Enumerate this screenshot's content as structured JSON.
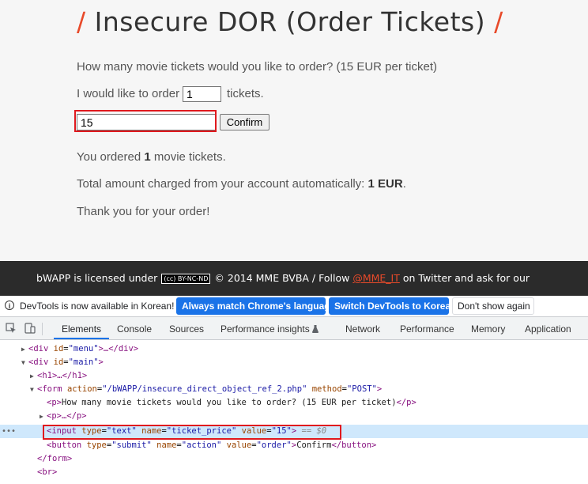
{
  "page": {
    "title_slash": "/",
    "title": "Insecure DOR (Order Tickets)",
    "question": "How many movie tickets would you like to order? (15 EUR per ticket)",
    "order_prefix": "I would like to order",
    "order_qty_value": "1",
    "order_suffix": "tickets.",
    "ticket_price_value": "15",
    "confirm_label": "Confirm",
    "ordered_prefix": "You ordered",
    "ordered_count": "1",
    "ordered_suffix": "movie tickets.",
    "total_prefix": "Total amount charged from your account automatically:",
    "total_amount": "1 EUR",
    "total_suffix": ".",
    "thanks": "Thank you for your order!"
  },
  "footer": {
    "licensed_prefix": "bWAPP is licensed under",
    "cc_badge": "(cc) BY-NC-ND",
    "copyright": "© 2014 MME BVBA / Follow",
    "twitter_handle": "@MME_IT",
    "suffix": "on Twitter and ask for our"
  },
  "devtools": {
    "infobar": {
      "icon": "info-icon",
      "text": "DevTools is now available in Korean!",
      "btn_match": "Always match Chrome's language",
      "btn_switch": "Switch DevTools to Korean",
      "btn_dont_show": "Don't show again"
    },
    "tabs": [
      "Elements",
      "Console",
      "Sources",
      "Performance insights",
      "Network",
      "Performance",
      "Memory",
      "Application"
    ],
    "active_tab": "Elements",
    "tree": {
      "r0": {
        "open": "<div",
        "attr": "id",
        "val": "\"menu\"",
        "close_tag": ">…</div>"
      },
      "r1": {
        "open": "<div",
        "attr": "id",
        "val": "\"main\"",
        "close_tag": ">"
      },
      "r2": {
        "tag": "<h1>…</h1>"
      },
      "r3": {
        "open": "<form",
        "attr1": "action",
        "val1": "\"/bWAPP/insecure_direct_object_ref_2.php\"",
        "attr2": "method",
        "val2": "\"POST\"",
        "close_tag": ">"
      },
      "r4": {
        "open": "<p>",
        "text": "How many movie tickets would you like to order? (15 EUR per ticket)",
        "close": "</p>"
      },
      "r5": {
        "tag": "<p>…</p>"
      },
      "r6": {
        "open": "<input",
        "attr1": "type",
        "val1": "\"text\"",
        "attr2": "name",
        "val2": "\"ticket_price\"",
        "attr3": "value",
        "val3": "\"15\"",
        "close_tag": ">",
        "marker": "== $0"
      },
      "r7": {
        "open": "<button",
        "attr1": "type",
        "val1": "\"submit\"",
        "attr2": "name",
        "val2": "\"action\"",
        "attr3": "value",
        "val3": "\"order\"",
        "text": "Confirm",
        "close": "</button>"
      },
      "r8": {
        "tag": "</form>"
      },
      "r9": {
        "tag": "<br>"
      }
    }
  },
  "colors": {
    "accent_red": "#e84a2a",
    "highlight_red": "#e0191e",
    "devtools_blue": "#1a73e8"
  }
}
